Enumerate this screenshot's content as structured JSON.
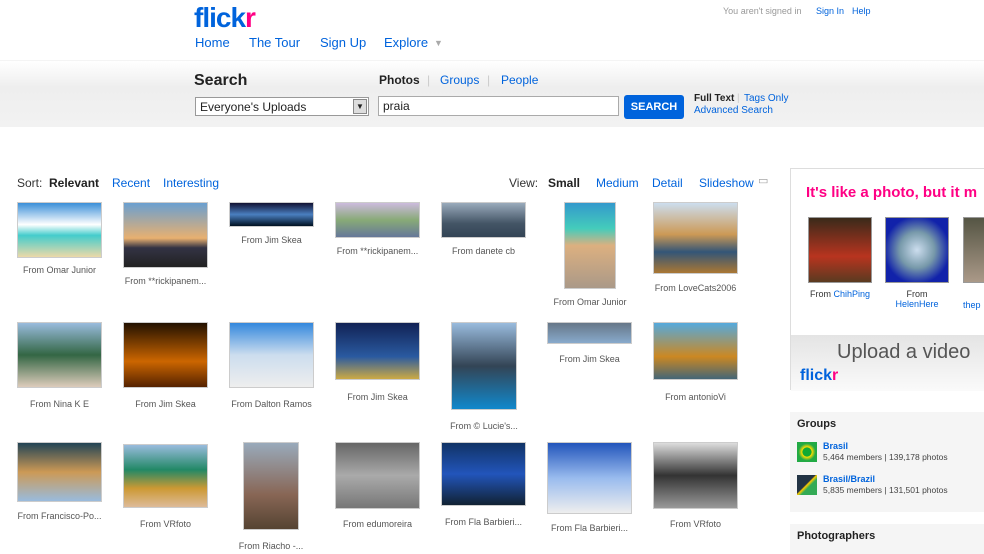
{
  "header": {
    "logo": "flickr",
    "signed_status": "You aren't signed in",
    "sign_in": "Sign In",
    "help": "Help",
    "nav": [
      "Home",
      "The Tour",
      "Sign Up",
      "Explore"
    ]
  },
  "search": {
    "title": "Search",
    "tabs": [
      "Photos",
      "Groups",
      "People"
    ],
    "scope": "Everyone's Uploads",
    "query": "praia",
    "button": "SEARCH",
    "full_text": "Full Text",
    "tags_only": "Tags Only",
    "advanced": "Advanced Search"
  },
  "sort": {
    "label": "Sort:",
    "options": [
      "Relevant",
      "Recent",
      "Interesting"
    ]
  },
  "view": {
    "label": "View:",
    "options": [
      "Small",
      "Medium",
      "Detail",
      "Slideshow"
    ]
  },
  "photos": [
    {
      "caption": "From Omar Junior"
    },
    {
      "caption": "From **rickipanem..."
    },
    {
      "caption": "From Jim Skea"
    },
    {
      "caption": "From **rickipanem..."
    },
    {
      "caption": "From danete cb"
    },
    {
      "caption": "From Omar Junior"
    },
    {
      "caption": "From LoveCats2006"
    },
    {
      "caption": "From Nina K E"
    },
    {
      "caption": "From Jim Skea"
    },
    {
      "caption": "From Dalton Ramos"
    },
    {
      "caption": "From Jim Skea"
    },
    {
      "caption": "From © Lucie's..."
    },
    {
      "caption": "From Jim Skea"
    },
    {
      "caption": "From antonioVi"
    },
    {
      "caption": "From Francisco-Po..."
    },
    {
      "caption": "From VRfoto"
    },
    {
      "caption": "From Riacho -..."
    },
    {
      "caption": "From edumoreira"
    },
    {
      "caption": "From Fla Barbieri..."
    },
    {
      "caption": "From Fla Barbieri..."
    },
    {
      "caption": "From VRfoto"
    }
  ],
  "promo": {
    "headline": "It's like a photo, but it m",
    "items": [
      {
        "from": "From",
        "user": "ChihPing"
      },
      {
        "from": "From",
        "user": "HelenHere"
      },
      {
        "from": "",
        "user": "thep"
      }
    ],
    "upload": "Upload a video",
    "logo": "flickr"
  },
  "groups": {
    "title": "Groups",
    "items": [
      {
        "name": "Brasil",
        "stats": "5,464 members | 139,178 photos"
      },
      {
        "name": "Brasil/Brazil",
        "stats": "5,835 members | 131,501 photos"
      }
    ]
  },
  "photographers": {
    "title": "Photographers"
  }
}
